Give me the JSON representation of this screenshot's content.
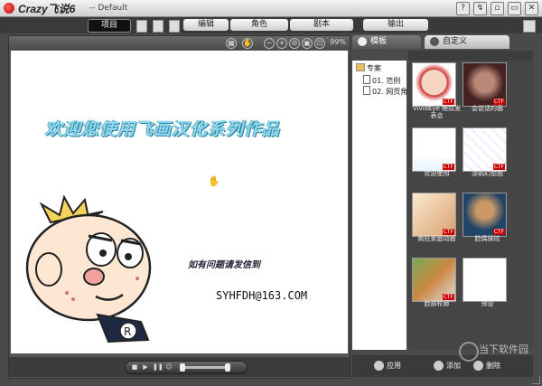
{
  "titlebar": {
    "title": "Crazy飞说6",
    "subtitle": "-- Default",
    "buttons": [
      "?",
      "↯",
      "▫",
      "▭",
      "✕"
    ]
  },
  "menubar": {
    "tabs": [
      {
        "label": "项目",
        "active": true
      },
      {
        "label": "编辑",
        "active": false
      },
      {
        "label": "角色",
        "active": false
      },
      {
        "label": "剧本",
        "active": false
      },
      {
        "label": "输出",
        "active": false
      }
    ]
  },
  "stage": {
    "zoom": "99%",
    "headline": "欢迎您使用飞画汉化系列作品",
    "subline": "如有问题请发信到",
    "email": "SYHFDH@163.COM"
  },
  "panel": {
    "tab_template": "模板",
    "tab_custom": "自定义",
    "tree": [
      {
        "label": "专案",
        "type": "folder"
      },
      {
        "label": "01. 范例",
        "type": "doc"
      },
      {
        "label": "02. 网页角色",
        "type": "doc"
      }
    ],
    "cards": [
      {
        "caption": "VividEye 眼纹发表会",
        "badge": "CTF"
      },
      {
        "caption": "会说话的画",
        "badge": "CTF"
      },
      {
        "caption": "欢迎使用",
        "badge": "CTF"
      },
      {
        "caption": "涂鸦幻想曲",
        "badge": "CTF"
      },
      {
        "caption": "疯狂家庭动画",
        "badge": "CTF"
      },
      {
        "caption": "脸偶操控",
        "badge": "CTF"
      },
      {
        "caption": "脸部轮廓",
        "badge": "CTF"
      },
      {
        "caption": "预设",
        "badge": ""
      }
    ],
    "footer_apply": "应用",
    "footer_add": "添加",
    "footer_delete": "删除"
  },
  "watermark": "当下软件园",
  "colors": {
    "background": "#4a4a4a",
    "headline": "#8fd8ee",
    "badge": "#cc0000"
  }
}
